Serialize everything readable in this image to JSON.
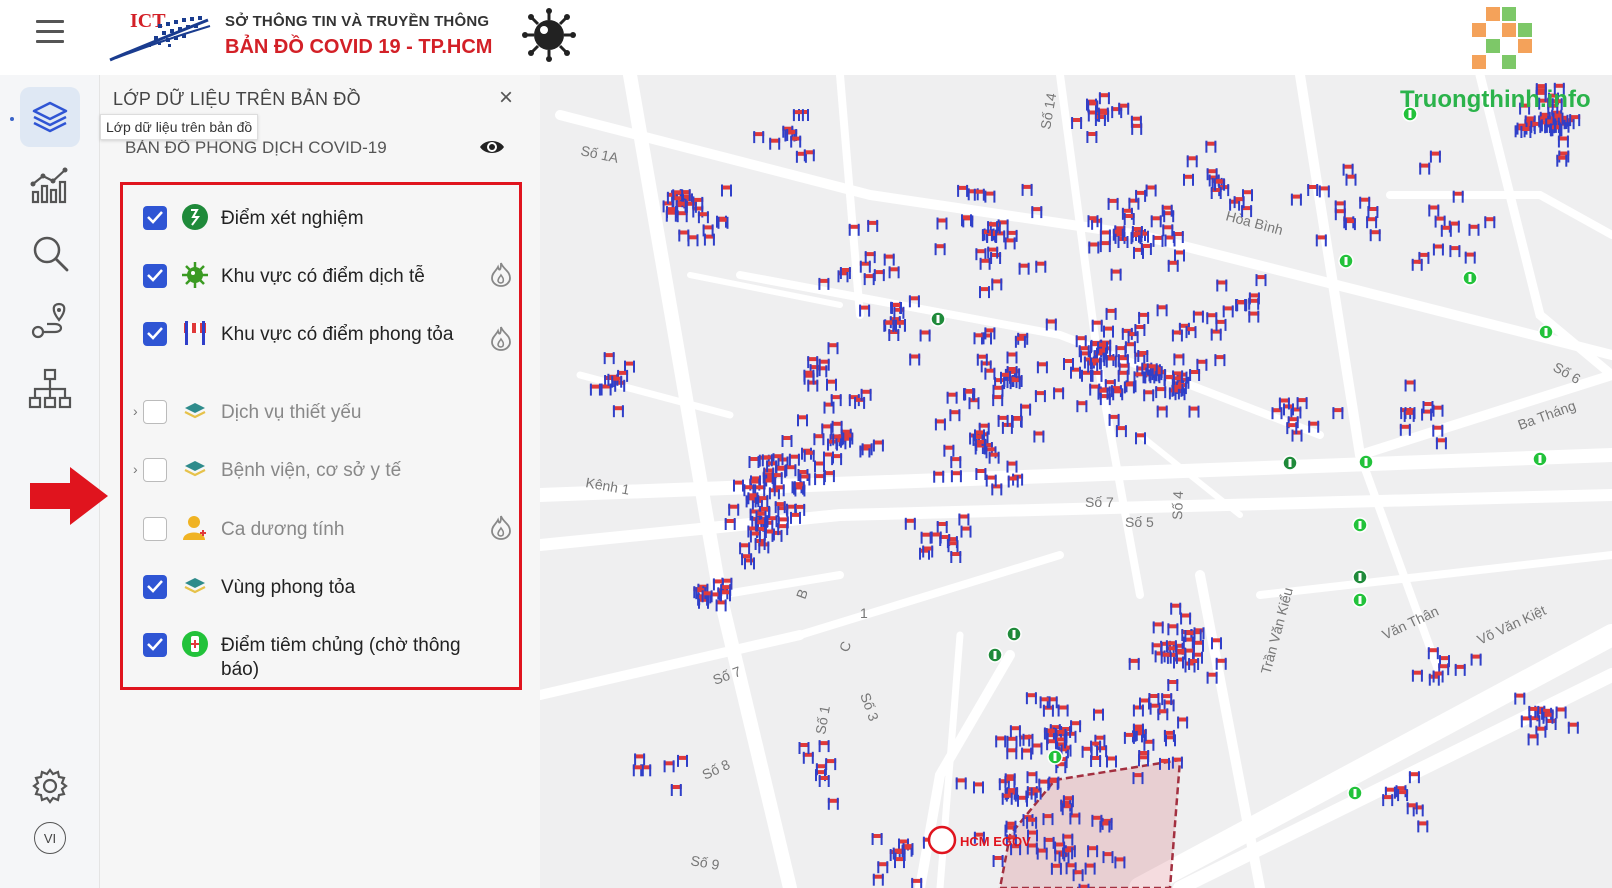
{
  "header": {
    "menu_icon": "hamburger-menu-icon",
    "org_logo_text": "ICT",
    "org_name": "SỞ THÔNG TIN VÀ TRUYỀN THÔNG",
    "app_title": "BẢN ĐỒ  COVID 19 - TP.HCM",
    "virus_icon": "virus-icon"
  },
  "rail": {
    "items": [
      {
        "icon": "layers-icon",
        "active": true
      },
      {
        "icon": "chart-icon",
        "active": false
      },
      {
        "icon": "search-icon",
        "active": false
      },
      {
        "icon": "route-icon",
        "active": false
      },
      {
        "icon": "hierarchy-icon",
        "active": false
      }
    ],
    "settings_icon": "gear-icon",
    "language": "VI"
  },
  "panel": {
    "title": "LỚP DỮ LIỆU TRÊN BẢN ĐỒ",
    "close_symbol": "×",
    "tooltip": "Lớp dữ liệu trên bản đồ",
    "group_label": "BẢN ĐỒ PHÒNG DỊCH COVID-19",
    "layers": [
      {
        "label": "Điểm xét nghiệm",
        "checked": true,
        "icon": "test-point-icon",
        "heat": false
      },
      {
        "label": "Khu vực có điểm dịch tễ",
        "checked": true,
        "icon": "virus-green-icon",
        "heat": true
      },
      {
        "label": "Khu vực có điểm phong tỏa",
        "checked": true,
        "icon": "barrier-icon",
        "heat": true
      },
      {
        "label": "Dịch vụ thiết yếu",
        "checked": false,
        "icon": "layer-stack-icon",
        "heat": false
      },
      {
        "label": "Bệnh viện, cơ sở y tế",
        "checked": false,
        "icon": "layer-stack-icon",
        "heat": false
      },
      {
        "label": "Ca dương tính",
        "checked": false,
        "icon": "person-icon",
        "heat": true
      },
      {
        "label": "Vùng phong tỏa",
        "checked": true,
        "icon": "layer-stack-icon",
        "heat": false
      },
      {
        "label": "Điểm tiêm chủng (chờ thông báo)",
        "checked": true,
        "icon": "vaccine-point-icon",
        "heat": false
      }
    ]
  },
  "map": {
    "street_labels": [
      "Số 1A",
      "Số 14",
      "Hòa Bình",
      "Kênh 1",
      "Số 7",
      "Số 5",
      "Số 4",
      "Ba Tháng",
      "Số 6",
      "B",
      "C",
      "1",
      "Số 7",
      "Số 3",
      "Số 1",
      "Số 8",
      "Số 9",
      "Trần Văn Kiểu",
      "Văn Thân",
      "Võ Văn Kiệt"
    ],
    "egov_logo": "HCM EGOV"
  },
  "watermark": "Truongthinh.info",
  "colors": {
    "accent": "#2f55d4",
    "highlight_box": "#e0141e",
    "title_red": "#d32027",
    "marker_red": "#e03a3a",
    "marker_blue": "#2f3fc9",
    "test_green": "#1f8a3a"
  }
}
